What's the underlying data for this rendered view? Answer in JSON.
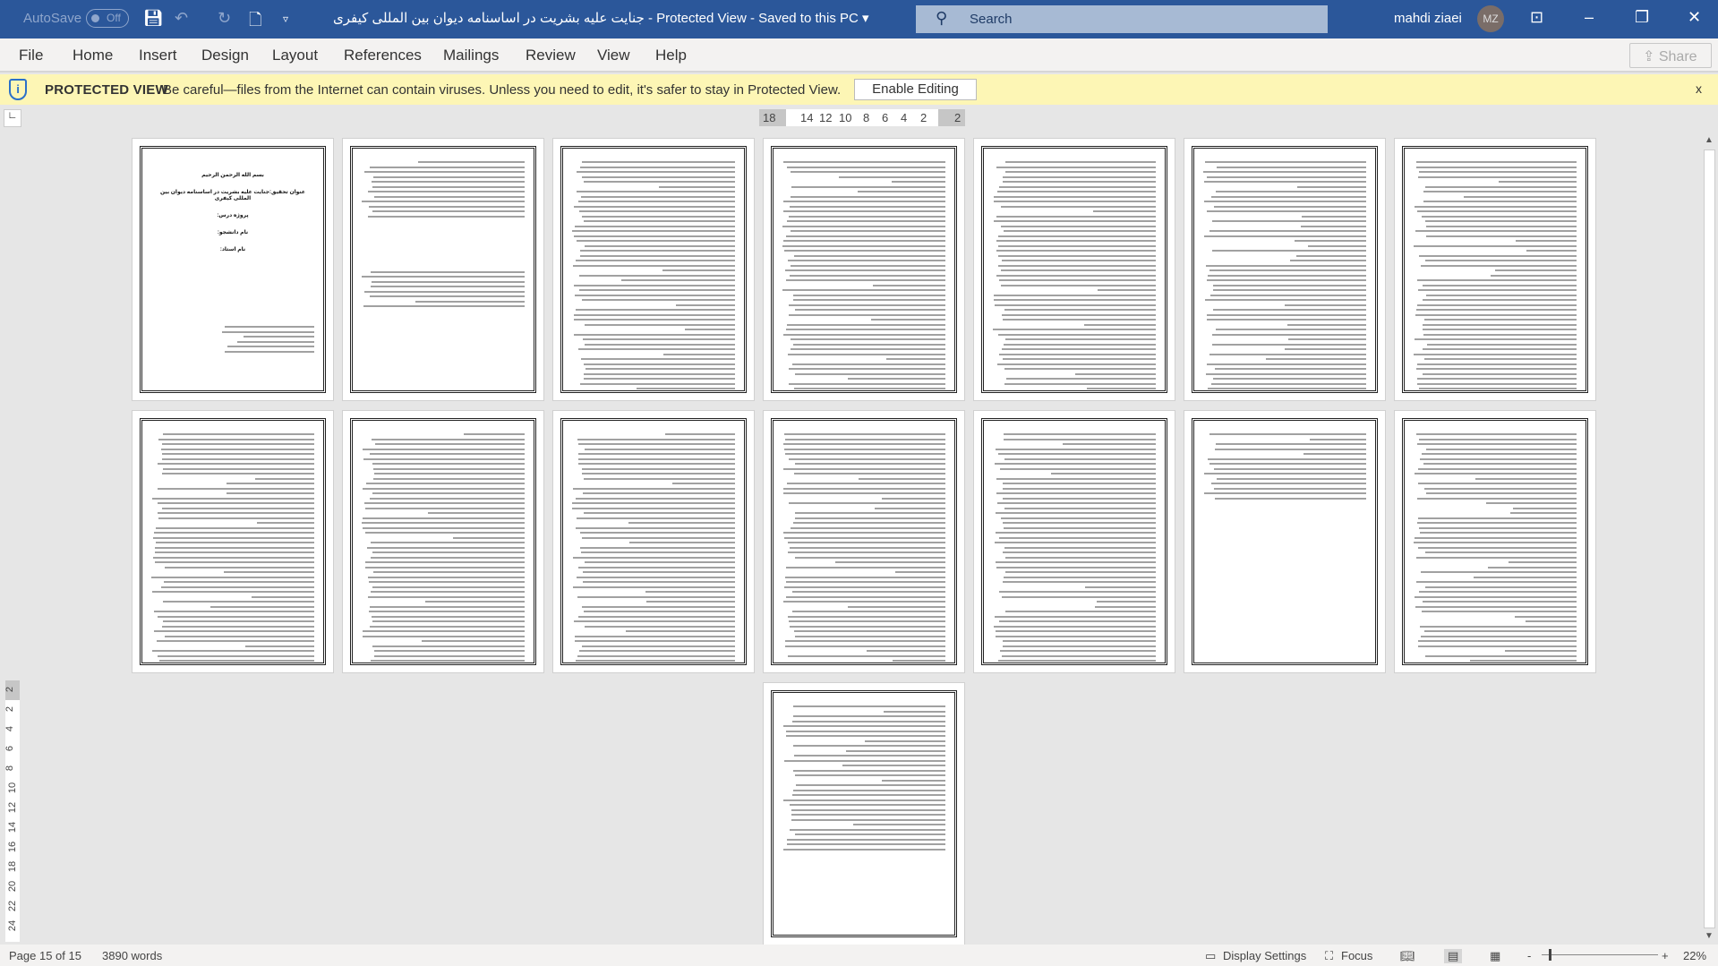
{
  "titlebar": {
    "autosave_label": "AutoSave",
    "autosave_state": "Off",
    "document_title": "جنایت علیه بشریت در اساسنامه دیوان بین المللی کیفری  -  Protected View  -  Saved to this PC ▾",
    "search_placeholder": "Search",
    "user_name": "mahdi ziaei",
    "user_initials": "MZ"
  },
  "menu": {
    "tabs": [
      "File",
      "Home",
      "Insert",
      "Design",
      "Layout",
      "References",
      "Mailings",
      "Review",
      "View",
      "Help"
    ],
    "share_label": "Share"
  },
  "protected_view": {
    "title": "PROTECTED VIEW",
    "message": "Be careful—files from the Internet can contain viruses. Unless you need to edit, it's safer to stay in Protected View.",
    "enable_label": "Enable Editing",
    "close": "x"
  },
  "ruler": {
    "horizontal": [
      "18",
      "14",
      "12",
      "10",
      "8",
      "6",
      "4",
      "2",
      "2"
    ],
    "vertical": [
      "2",
      "2",
      "4",
      "6",
      "8",
      "10",
      "12",
      "14",
      "16",
      "18",
      "20",
      "22",
      "24"
    ]
  },
  "cover_page": {
    "lines": [
      "بسم الله الرحمن الرحیم",
      "عنوان تحقیق:جنایت علیه بشریت در اساسنامه دیوان بین المللی کیفری",
      "پروژه درس:",
      "نام دانشجو:",
      "نام استاد:"
    ]
  },
  "status": {
    "page": "Page 15 of 15",
    "words": "3890 words",
    "display_settings": "Display Settings",
    "focus": "Focus",
    "zoom": "22%",
    "zoom_minus": "-",
    "zoom_plus": "+"
  }
}
